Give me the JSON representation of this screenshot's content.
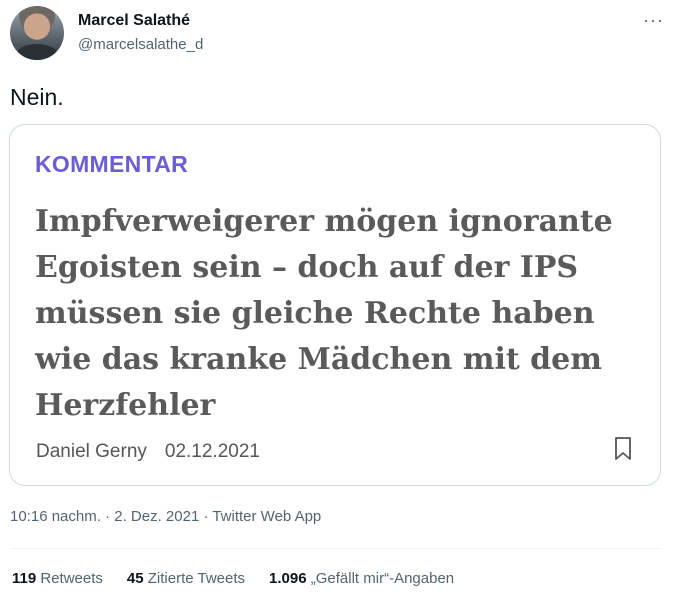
{
  "author": {
    "name": "Marcel Salathé",
    "handle": "@marcelsalathe_d",
    "more_icon": "more-horizontal-icon"
  },
  "tweet": {
    "text": "Nein."
  },
  "card": {
    "kicker": "KOMMENTAR",
    "headline": "Impfverweigerer mögen ignorante Egoisten sein – doch auf der IPS müssen sie gleiche Rechte haben wie das kranke Mädchen mit dem Herzfehler",
    "author": "Daniel Gerny",
    "date": "02.12.2021",
    "bookmark_icon": "bookmark-icon",
    "kicker_color": "#6b5dd3"
  },
  "meta": {
    "line": "10:16 nachm. · 2. Dez. 2021 · Twitter Web App"
  },
  "stats": {
    "retweets_count": "119",
    "retweets_label": "Retweets",
    "quotes_count": "45",
    "quotes_label": "Zitierte Tweets",
    "likes_count": "1.096",
    "likes_label": "„Gefällt mir“-Angaben"
  }
}
